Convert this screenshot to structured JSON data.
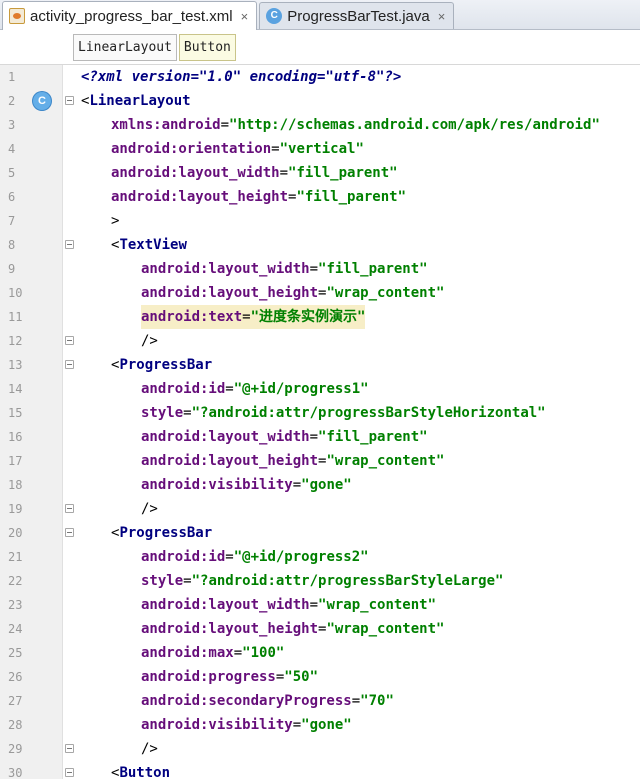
{
  "tabs": [
    {
      "label": "activity_progress_bar_test.xml",
      "close": "×",
      "icon": "xml-file-icon",
      "active": true
    },
    {
      "label": "ProgressBarTest.java",
      "close": "×",
      "icon": "java-class-icon",
      "active": false
    }
  ],
  "breadcrumb": [
    "LinearLayout",
    "Button"
  ],
  "gutter_badge": "C",
  "lines": [
    {
      "n": "1",
      "tokens": [
        [
          "decl",
          "<?xml version=\"1.0\" encoding=\"utf-8\"?>"
        ]
      ]
    },
    {
      "n": "2",
      "tokens": [
        [
          "punct",
          "<"
        ],
        [
          "tag",
          "LinearLayout"
        ]
      ]
    },
    {
      "n": "3",
      "tokens": [
        [
          "attr",
          "xmlns:android"
        ],
        [
          "punct",
          "="
        ],
        [
          "str",
          "\"http://schemas.android.com/apk/res/android\""
        ]
      ]
    },
    {
      "n": "4",
      "tokens": [
        [
          "attr",
          "android:orientation"
        ],
        [
          "punct",
          "="
        ],
        [
          "str",
          "\"vertical\""
        ]
      ]
    },
    {
      "n": "5",
      "tokens": [
        [
          "attr",
          "android:layout_width"
        ],
        [
          "punct",
          "="
        ],
        [
          "str",
          "\"fill_parent\""
        ]
      ]
    },
    {
      "n": "6",
      "tokens": [
        [
          "attr",
          "android:layout_height"
        ],
        [
          "punct",
          "="
        ],
        [
          "str",
          "\"fill_parent\""
        ]
      ]
    },
    {
      "n": "7",
      "tokens": [
        [
          "punct",
          ">"
        ]
      ]
    },
    {
      "n": "8",
      "tokens": [
        [
          "punct",
          "<"
        ],
        [
          "tag",
          "TextView"
        ]
      ]
    },
    {
      "n": "9",
      "tokens": [
        [
          "attr",
          "android:layout_width"
        ],
        [
          "punct",
          "="
        ],
        [
          "str",
          "\"fill_parent\""
        ]
      ]
    },
    {
      "n": "10",
      "tokens": [
        [
          "attr",
          "android:layout_height"
        ],
        [
          "punct",
          "="
        ],
        [
          "str",
          "\"wrap_content\""
        ]
      ]
    },
    {
      "n": "11",
      "tokens": [
        [
          "attr",
          "android:text"
        ],
        [
          "punct",
          "="
        ],
        [
          "str",
          "\"进度条实例演示\""
        ]
      ],
      "highlight": true
    },
    {
      "n": "12",
      "tokens": [
        [
          "punct",
          "/>"
        ]
      ]
    },
    {
      "n": "13",
      "tokens": [
        [
          "punct",
          "<"
        ],
        [
          "tag",
          "ProgressBar"
        ]
      ]
    },
    {
      "n": "14",
      "tokens": [
        [
          "attr",
          "android:id"
        ],
        [
          "punct",
          "="
        ],
        [
          "str",
          "\"@+id/progress1\""
        ]
      ]
    },
    {
      "n": "15",
      "tokens": [
        [
          "attr",
          "style"
        ],
        [
          "punct",
          "="
        ],
        [
          "str",
          "\"?android:attr/progressBarStyleHorizontal\""
        ]
      ]
    },
    {
      "n": "16",
      "tokens": [
        [
          "attr",
          "android:layout_width"
        ],
        [
          "punct",
          "="
        ],
        [
          "str",
          "\"fill_parent\""
        ]
      ]
    },
    {
      "n": "17",
      "tokens": [
        [
          "attr",
          "android:layout_height"
        ],
        [
          "punct",
          "="
        ],
        [
          "str",
          "\"wrap_content\""
        ]
      ]
    },
    {
      "n": "18",
      "tokens": [
        [
          "attr",
          "android:visibility"
        ],
        [
          "punct",
          "="
        ],
        [
          "str",
          "\"gone\""
        ]
      ]
    },
    {
      "n": "19",
      "tokens": [
        [
          "punct",
          "/>"
        ]
      ]
    },
    {
      "n": "20",
      "tokens": [
        [
          "punct",
          "<"
        ],
        [
          "tag",
          "ProgressBar"
        ]
      ]
    },
    {
      "n": "21",
      "tokens": [
        [
          "attr",
          "android:id"
        ],
        [
          "punct",
          "="
        ],
        [
          "str",
          "\"@+id/progress2\""
        ]
      ]
    },
    {
      "n": "22",
      "tokens": [
        [
          "attr",
          "style"
        ],
        [
          "punct",
          "="
        ],
        [
          "str",
          "\"?android:attr/progressBarStyleLarge\""
        ]
      ]
    },
    {
      "n": "23",
      "tokens": [
        [
          "attr",
          "android:layout_width"
        ],
        [
          "punct",
          "="
        ],
        [
          "str",
          "\"wrap_content\""
        ]
      ]
    },
    {
      "n": "24",
      "tokens": [
        [
          "attr",
          "android:layout_height"
        ],
        [
          "punct",
          "="
        ],
        [
          "str",
          "\"wrap_content\""
        ]
      ]
    },
    {
      "n": "25",
      "tokens": [
        [
          "attr",
          "android:max"
        ],
        [
          "punct",
          "="
        ],
        [
          "str",
          "\"100\""
        ]
      ]
    },
    {
      "n": "26",
      "tokens": [
        [
          "attr",
          "android:progress"
        ],
        [
          "punct",
          "="
        ],
        [
          "str",
          "\"50\""
        ]
      ]
    },
    {
      "n": "27",
      "tokens": [
        [
          "attr",
          "android:secondaryProgress"
        ],
        [
          "punct",
          "="
        ],
        [
          "str",
          "\"70\""
        ]
      ]
    },
    {
      "n": "28",
      "tokens": [
        [
          "attr",
          "android:visibility"
        ],
        [
          "punct",
          "="
        ],
        [
          "str",
          "\"gone\""
        ]
      ]
    },
    {
      "n": "29",
      "tokens": [
        [
          "punct",
          "/>"
        ]
      ]
    },
    {
      "n": "30",
      "tokens": [
        [
          "punct",
          "<"
        ],
        [
          "tag",
          "Button"
        ]
      ]
    }
  ],
  "colors": {
    "tag": "#000080",
    "attribute": "#660e7a",
    "string": "#008000",
    "highlight": "#f7eec7",
    "gutter": "#f0f0f0"
  }
}
